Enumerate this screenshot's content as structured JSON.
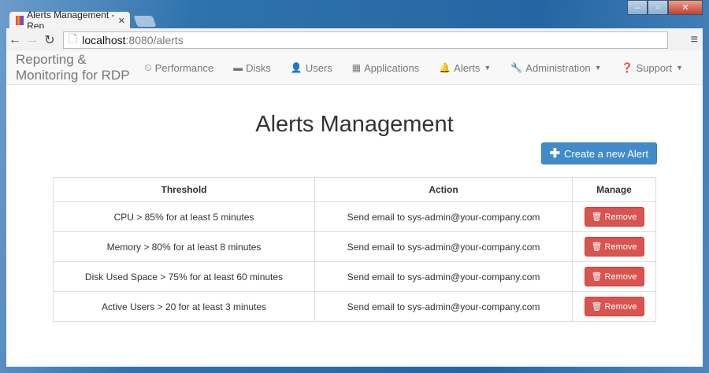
{
  "browser": {
    "tab_title": "Alerts Management - Rep",
    "url_host": "localhost",
    "url_rest": ":8080/alerts"
  },
  "nav": {
    "brand": "Reporting & Monitoring for RDP",
    "items": [
      {
        "label": "Performance",
        "icon": "⏲",
        "caret": false
      },
      {
        "label": "Disks",
        "icon": "▬",
        "caret": false
      },
      {
        "label": "Users",
        "icon": "👤",
        "caret": false
      },
      {
        "label": "Applications",
        "icon": "▦",
        "caret": false
      },
      {
        "label": "Alerts",
        "icon": "🔔",
        "caret": true
      },
      {
        "label": "Administration",
        "icon": "🔧",
        "caret": true
      },
      {
        "label": "Support",
        "icon": "❓",
        "caret": true
      }
    ]
  },
  "main": {
    "title": "Alerts Management",
    "create_label": "Create a new Alert",
    "columns": [
      "Threshold",
      "Action",
      "Manage"
    ],
    "rows": [
      {
        "threshold": "CPU > 85% for at least 5 minutes",
        "action": "Send email to sys-admin@your-company.com",
        "button": "Remove"
      },
      {
        "threshold": "Memory > 80% for at least 8 minutes",
        "action": "Send email to sys-admin@your-company.com",
        "button": "Remove"
      },
      {
        "threshold": "Disk Used Space > 75% for at least 60 minutes",
        "action": "Send email to sys-admin@your-company.com",
        "button": "Remove"
      },
      {
        "threshold": "Active Users > 20 for at least 3 minutes",
        "action": "Send email to sys-admin@your-company.com",
        "button": "Remove"
      }
    ]
  }
}
